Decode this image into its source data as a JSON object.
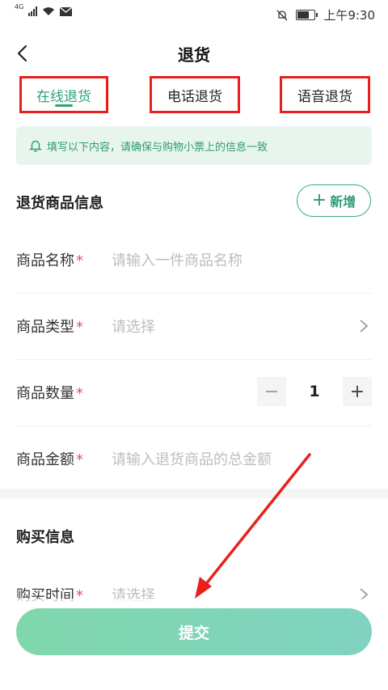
{
  "status_bar": {
    "network": "4G",
    "time": "上午9:30"
  },
  "header": {
    "title": "退货"
  },
  "tabs": [
    {
      "label": "在线退货",
      "active": true
    },
    {
      "label": "电话退货",
      "active": false
    },
    {
      "label": "语音退货",
      "active": false
    }
  ],
  "notice": {
    "text": "填写以下内容，请确保与购物小票上的信息一致"
  },
  "goods_section": {
    "title": "退货商品信息",
    "add_label": "新增",
    "fields": [
      {
        "label": "商品名称",
        "placeholder": "请输入一件商品名称"
      },
      {
        "label": "商品类型",
        "placeholder": "请选择"
      },
      {
        "label": "商品数量",
        "value": "1"
      },
      {
        "label": "商品金额",
        "placeholder": "请输入退货商品的总金额"
      }
    ],
    "required_mark": "*",
    "minus": "−",
    "plus": "+"
  },
  "purchase_section": {
    "title": "购买信息",
    "fields": [
      {
        "label": "购买时间",
        "placeholder": "请选择"
      }
    ]
  },
  "submit_label": "提交",
  "colors": {
    "accent": "#2aa37a",
    "highlight": "#e8201c",
    "required": "#e8514a"
  }
}
